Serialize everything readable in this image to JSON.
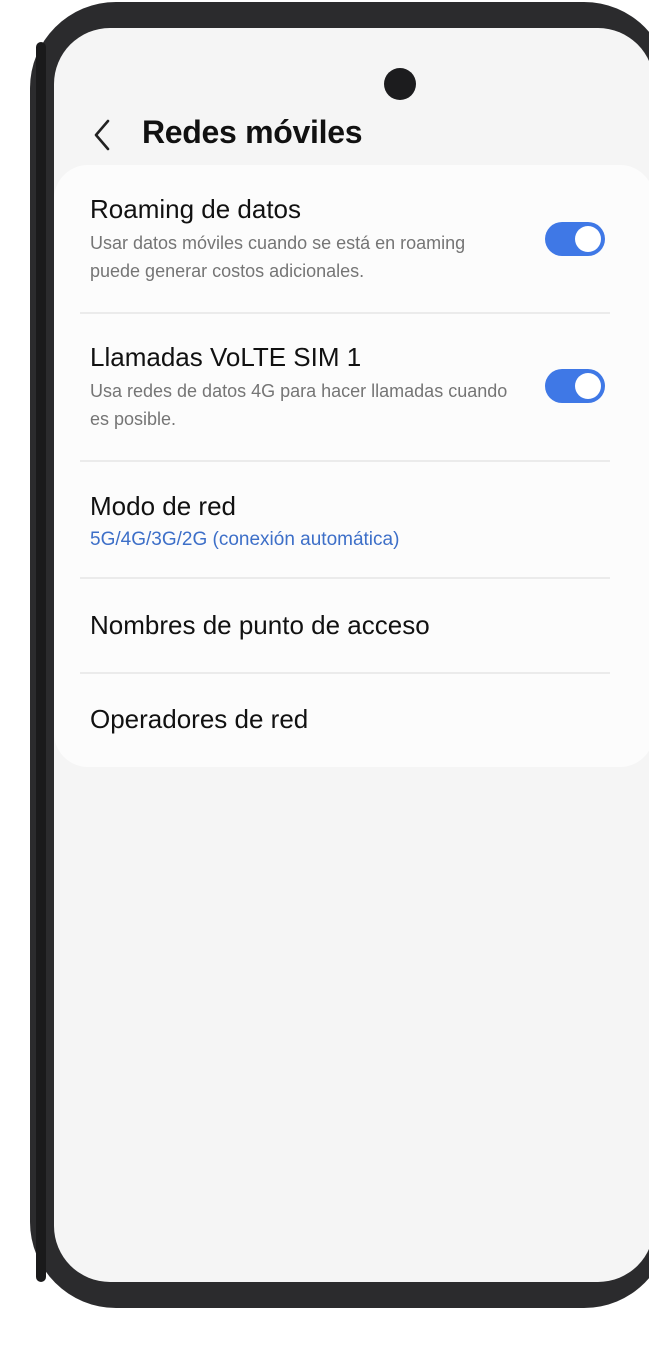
{
  "header": {
    "title": "Redes móviles",
    "back_icon": "chevron-left-icon"
  },
  "settings": {
    "data_roaming": {
      "title": "Roaming de datos",
      "subtitle": "Usar datos móviles cuando se está en roaming puede generar costos adicionales.",
      "enabled": true
    },
    "volte": {
      "title": "Llamadas VoLTE SIM 1",
      "subtitle": "Usa redes de datos 4G para hacer llamadas cuando es posible.",
      "enabled": true
    },
    "network_mode": {
      "title": "Modo de red",
      "value": "5G/4G/3G/2G (conexión automática)"
    },
    "apn": {
      "title": "Nombres de punto de acceso"
    },
    "operators": {
      "title": "Operadores de red"
    }
  },
  "colors": {
    "accent": "#3f78e6",
    "link_text": "#3d6fc8",
    "background": "#f5f5f5",
    "card": "#fcfcfc"
  }
}
